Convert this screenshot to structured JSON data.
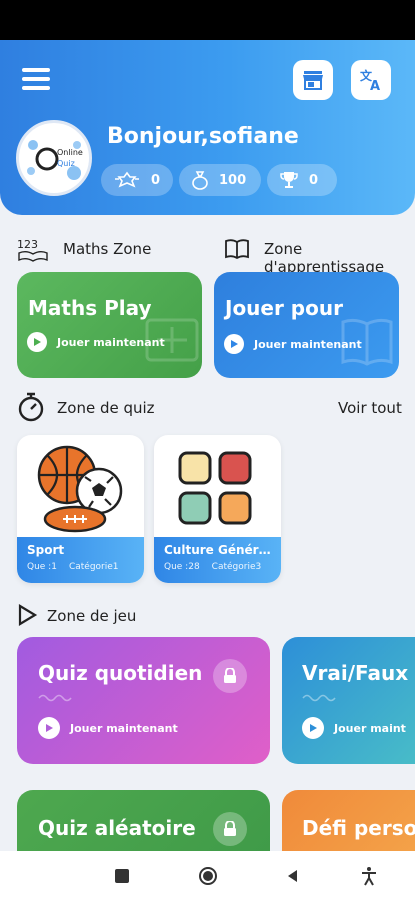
{
  "header": {
    "greeting": "Bonjour,sofiane",
    "avatar_text_top": "Online",
    "avatar_text_bottom": "Quiz",
    "stats": [
      {
        "icon": "badge-icon",
        "value": "0"
      },
      {
        "icon": "coins-icon",
        "value": "100"
      },
      {
        "icon": "trophy-icon",
        "value": "0"
      }
    ]
  },
  "zones": {
    "maths_zone": "Maths Zone",
    "learning_zone": "Zone d'apprentissage"
  },
  "top_cards": [
    {
      "title": "Maths Play",
      "action": "Jouer maintenant",
      "color": "#4caf50"
    },
    {
      "title": "Jouer pour",
      "action": "Jouer maintenant",
      "color": "#2f86e6"
    }
  ],
  "quiz_zone": {
    "title": "Zone de quiz",
    "see_all": "Voir tout",
    "items": [
      {
        "name": "Sport",
        "count": "Que :1",
        "category": "Catégorie1"
      },
      {
        "name": "Culture Généra...",
        "count": "Que :28",
        "category": "Catégorie3"
      }
    ]
  },
  "game_zone": {
    "title": "Zone de jeu",
    "cards": [
      {
        "title": "Quiz quotidien",
        "action": "Jouer maintenant"
      },
      {
        "title": "Vrai/Faux",
        "action": "Jouer maint"
      },
      {
        "title": "Quiz aléatoire",
        "action": ""
      },
      {
        "title": "Défi perso",
        "action": ""
      }
    ]
  }
}
